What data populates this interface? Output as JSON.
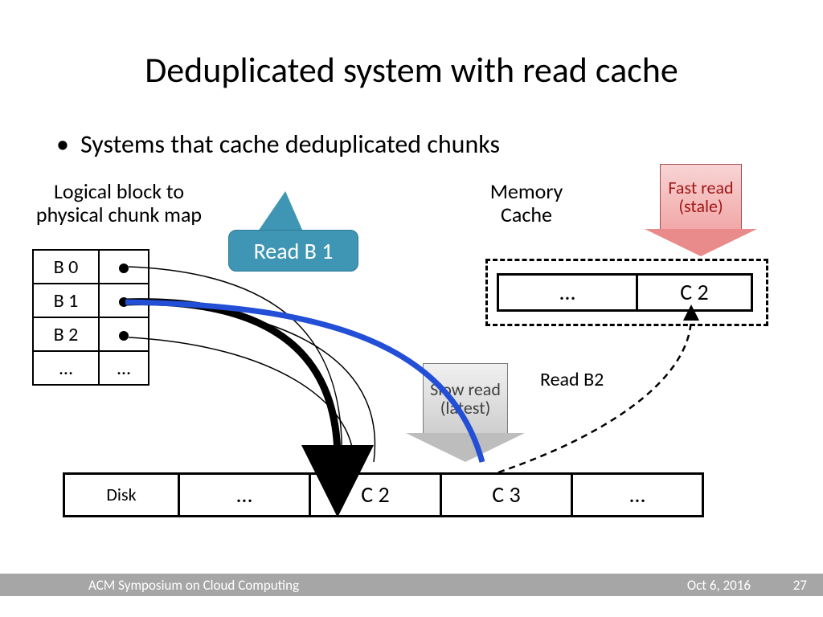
{
  "title": "Deduplicated system with read cache",
  "bullet": "Systems that cache deduplicated chunks",
  "map_label": "Logical block to physical chunk map",
  "mem_label": "Memory Cache",
  "callout": "Read B 1",
  "fast_read": "Fast read (stale)",
  "slow_read": "Slow read (latest)",
  "read_b2": "Read B2",
  "map_rows": {
    "r0": "B 0",
    "r1": "B 1",
    "r2": "B 2",
    "r3a": "…",
    "r3b": "…"
  },
  "cache": {
    "c1": "…",
    "c2": "C 2"
  },
  "disk": {
    "d0": "Disk",
    "d1": "…",
    "d2": "C 2",
    "d3": "C 3",
    "d4": "…"
  },
  "footer": {
    "venue": "ACM Symposium on Cloud Computing",
    "date": "Oct 6, 2016",
    "page": "27"
  }
}
